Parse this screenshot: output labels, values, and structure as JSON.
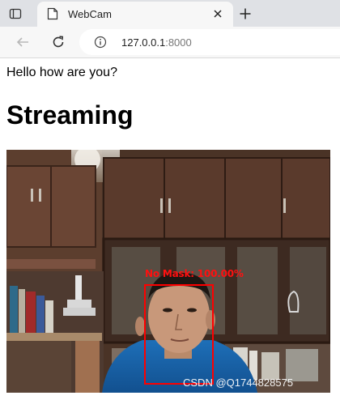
{
  "browser": {
    "tab": {
      "title": "WebCam",
      "close_icon": "close-icon",
      "favicon_icon": "page-icon"
    },
    "tab_actions_icon": "tab-actions-icon",
    "new_tab_icon": "plus-icon",
    "back_icon": "arrow-left-icon",
    "refresh_icon": "refresh-icon",
    "site_info_icon": "info-icon",
    "address": {
      "host": "127.0.0.1",
      "port": ":8000"
    }
  },
  "page": {
    "greeting": "Hello how are you?",
    "heading": "Streaming",
    "stream": {
      "detection_label": "No Mask: 100.00%",
      "detection_color": "#ff0000",
      "watermark": "CSDN @Q1744828575"
    }
  }
}
